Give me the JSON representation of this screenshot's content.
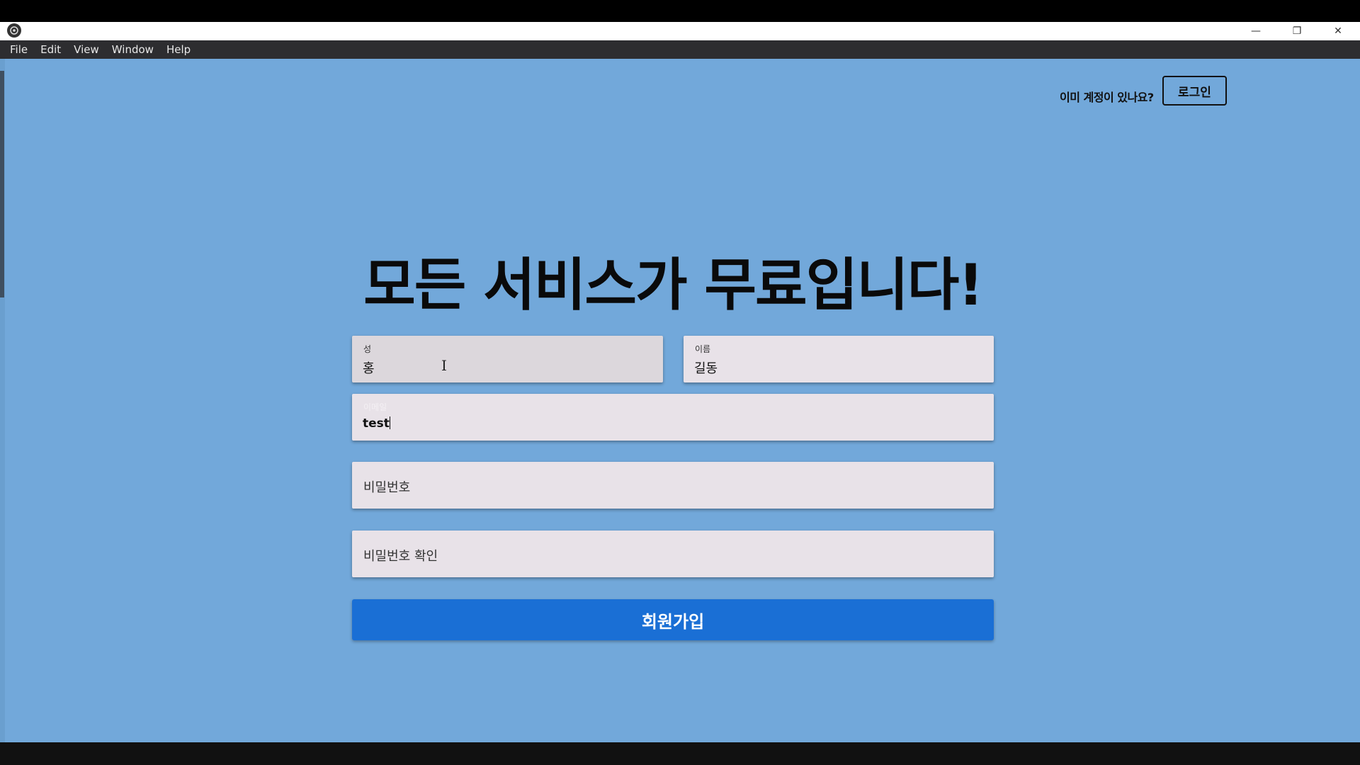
{
  "menu": {
    "items": [
      {
        "label": "File"
      },
      {
        "label": "Edit"
      },
      {
        "label": "View"
      },
      {
        "label": "Window"
      },
      {
        "label": "Help"
      }
    ]
  },
  "window_controls": {
    "minimize": "—",
    "restore": "❐",
    "close": "✕"
  },
  "auth": {
    "prompt": "이미 계정이 있나요?",
    "login_label": "로그인"
  },
  "headline": "모든 서비스가 무료입니다!",
  "form": {
    "last_name": {
      "label": "성",
      "value": "홍"
    },
    "first_name": {
      "label": "이름",
      "value": "길동"
    },
    "email": {
      "label": "이메일",
      "value": "test"
    },
    "password": {
      "placeholder": "비밀번호"
    },
    "password_confirm": {
      "placeholder": "비밀번호 확인"
    },
    "submit_label": "회원가입"
  },
  "colors": {
    "background": "#72a8da",
    "submit": "#1a6fd5",
    "field": "#e8e2e8"
  }
}
